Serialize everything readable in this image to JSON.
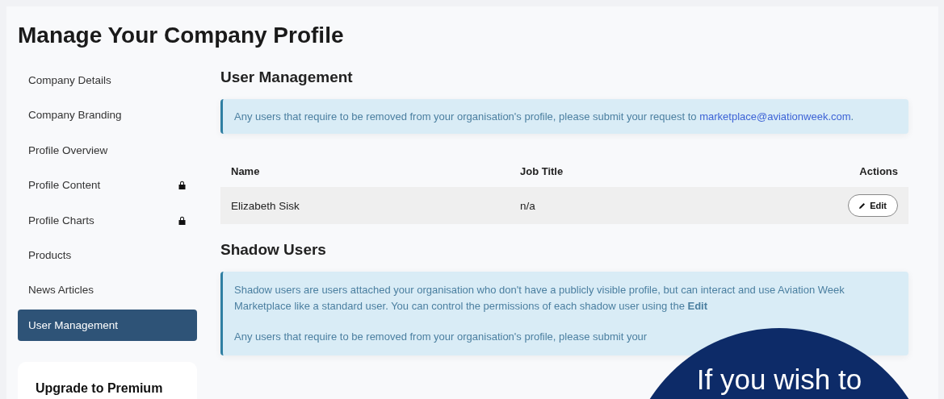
{
  "page_title": "Manage Your Company Profile",
  "sidebar": {
    "items": [
      {
        "label": "Company Details",
        "locked": false,
        "selected": false
      },
      {
        "label": "Company Branding",
        "locked": false,
        "selected": false
      },
      {
        "label": "Profile Overview",
        "locked": false,
        "selected": false
      },
      {
        "label": "Profile Content",
        "locked": true,
        "selected": false
      },
      {
        "label": "Profile Charts",
        "locked": true,
        "selected": false
      },
      {
        "label": "Products",
        "locked": false,
        "selected": false
      },
      {
        "label": "News Articles",
        "locked": false,
        "selected": false
      },
      {
        "label": "User Management",
        "locked": false,
        "selected": true
      }
    ],
    "upgrade_card": {
      "title": "Upgrade to Premium"
    }
  },
  "user_management": {
    "title": "User Management",
    "notice": {
      "text": "Any users that require to be removed from your organisation's profile, please submit your request to",
      "link": "marketplace@aviationweek.com",
      "after": "."
    },
    "table": {
      "columns": [
        "Name",
        "Job Title",
        "Actions"
      ],
      "rows": [
        {
          "name": "Elizabeth Sisk",
          "job_title": "n/a",
          "action": "Edit"
        }
      ]
    }
  },
  "shadow_users": {
    "title": "Shadow Users",
    "notice": [
      "Shadow users are users attached your organisation who don't have a publicly visible profile, but can interact and use Aviation Week Marketplace like a standard user. You can control the permissions of each shadow user using the **Edit**",
      "Any users that require to be removed from your organisation's profile, please submit your"
    ]
  },
  "overlay_bubble": {
    "text": "If you wish to"
  }
}
